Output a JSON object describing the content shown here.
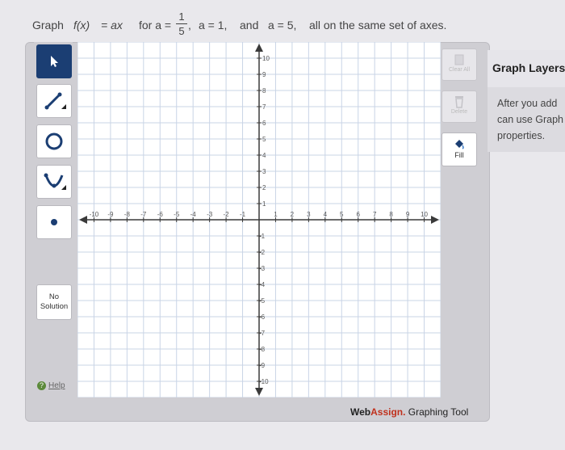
{
  "question": {
    "graph": "Graph",
    "fx": "f(x)",
    "eq": "= ax",
    "for_a": "for  a =",
    "frac_num": "1",
    "frac_den": "5",
    "comma": ",",
    "a1": "a = 1,",
    "and": "and",
    "a5": "a = 5,",
    "tail": "all on the same set of axes."
  },
  "tools": {
    "no_solution_line1": "No",
    "no_solution_line2": "Solution",
    "help": "Help"
  },
  "side": {
    "clear_all": "Clear All",
    "delete": "Delete",
    "fill": "Fill"
  },
  "branding": {
    "web": "Web",
    "assign": "Assign.",
    "tool": " Graphing Tool"
  },
  "layers": {
    "title": "Graph Layers",
    "line1": "After you add",
    "line2": "can use Graph",
    "line3": "properties."
  },
  "axes": {
    "x_ticks": [
      "-10",
      "-9",
      "-8",
      "-7",
      "-6",
      "-5",
      "-4",
      "-3",
      "-2",
      "-1",
      "1",
      "2",
      "3",
      "4",
      "5",
      "6",
      "7",
      "8",
      "9",
      "10"
    ],
    "y_ticks": [
      "10",
      "9",
      "8",
      "7",
      "6",
      "5",
      "4",
      "3",
      "2",
      "1",
      "-1",
      "-2",
      "-3",
      "-4",
      "-5",
      "-6",
      "-7",
      "-8",
      "-9",
      "-10"
    ],
    "range": [
      -10,
      10
    ]
  },
  "colors": {
    "active_tool": "#1b3e73",
    "brand_accent": "#c0311d",
    "grid": "#c9d4e6",
    "axis": "#3a3a3a"
  }
}
